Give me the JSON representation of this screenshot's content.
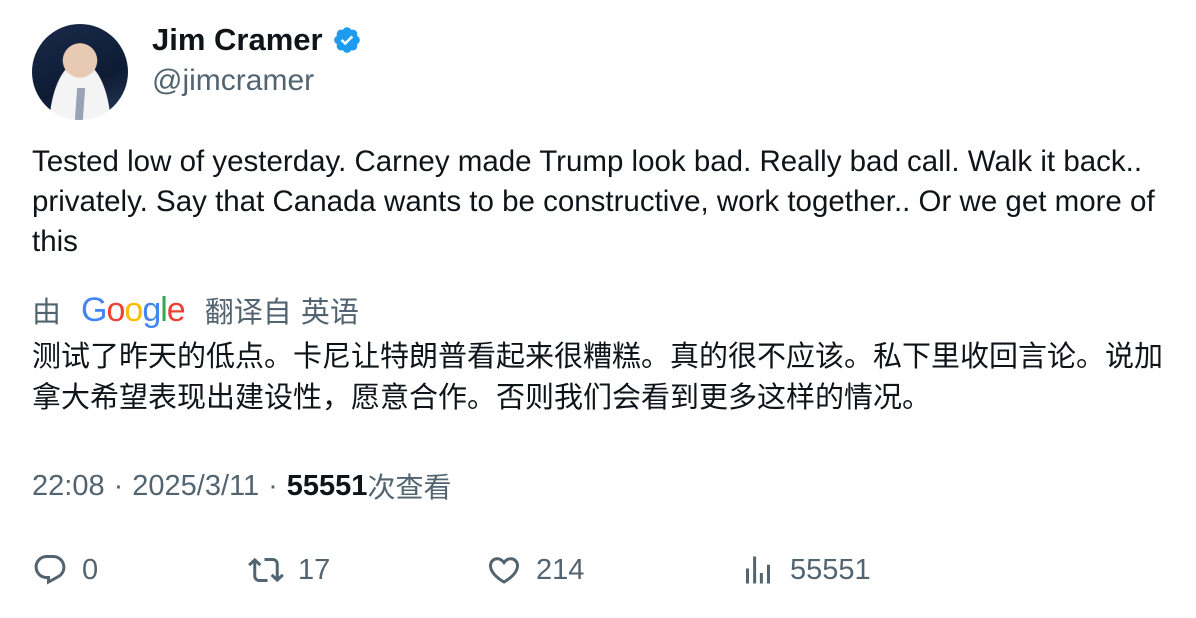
{
  "author": {
    "display_name": "Jim Cramer",
    "handle": "@jimcramer",
    "verified_icon": "verified-badge-icon",
    "accent_color": "#1d9bf0"
  },
  "tweet": {
    "text": "Tested low of yesterday. Carney made Trump look bad. Really bad call. Walk it back.. privately. Say that Canada wants to be constructive, work together..  Or we get more of this"
  },
  "translation": {
    "prefix": "由",
    "provider": "Google",
    "suffix": "翻译自 英语",
    "text": "测试了昨天的低点。卡尼让特朗普看起来很糟糕。真的很不应该。私下里收回言论。说加拿大希望表现出建设性，愿意合作。否则我们会看到更多这样的情况。"
  },
  "meta": {
    "time": "22:08",
    "separator": "·",
    "date": "2025/3/11",
    "views_count": "55551",
    "views_label": "次查看"
  },
  "actions": {
    "reply": "0",
    "retweet": "17",
    "like": "214",
    "views": "55551"
  }
}
